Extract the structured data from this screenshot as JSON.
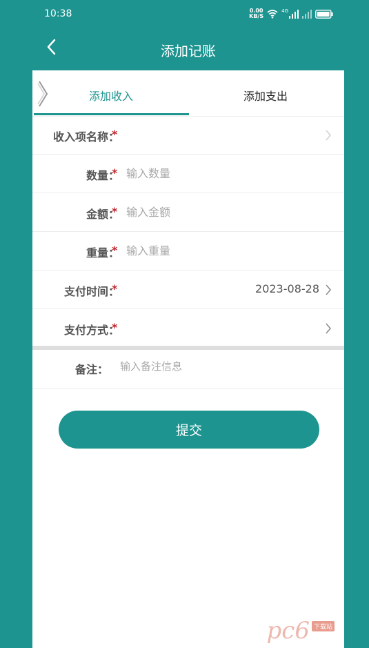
{
  "status_bar": {
    "time": "10:38",
    "net_speed": "0.00",
    "net_unit": "KB/S",
    "network": "4G"
  },
  "header": {
    "title": "添加记账"
  },
  "tabs": [
    {
      "label": "添加收入",
      "active": true
    },
    {
      "label": "添加支出",
      "active": false
    }
  ],
  "form": {
    "item_name": {
      "label": "收入项名称：",
      "required_mark": "*"
    },
    "quantity": {
      "label": "数量：",
      "required_mark": "*",
      "placeholder": "输入数量"
    },
    "amount": {
      "label": "金额：",
      "required_mark": "*",
      "placeholder": "输入金额"
    },
    "weight": {
      "label": "重量：",
      "required_mark": "*",
      "placeholder": "输入重量"
    },
    "pay_time": {
      "label": "支付时间：",
      "required_mark": "*",
      "value": "2023-08-28"
    },
    "pay_method": {
      "label": "支付方式：",
      "required_mark": "*"
    },
    "note": {
      "label": "备注：",
      "placeholder": "输入备注信息"
    }
  },
  "submit_label": "提交",
  "watermark": {
    "logo": "pc6",
    "tag": "下载站"
  },
  "colors": {
    "primary": "#1e9490",
    "required": "#c0272d"
  }
}
